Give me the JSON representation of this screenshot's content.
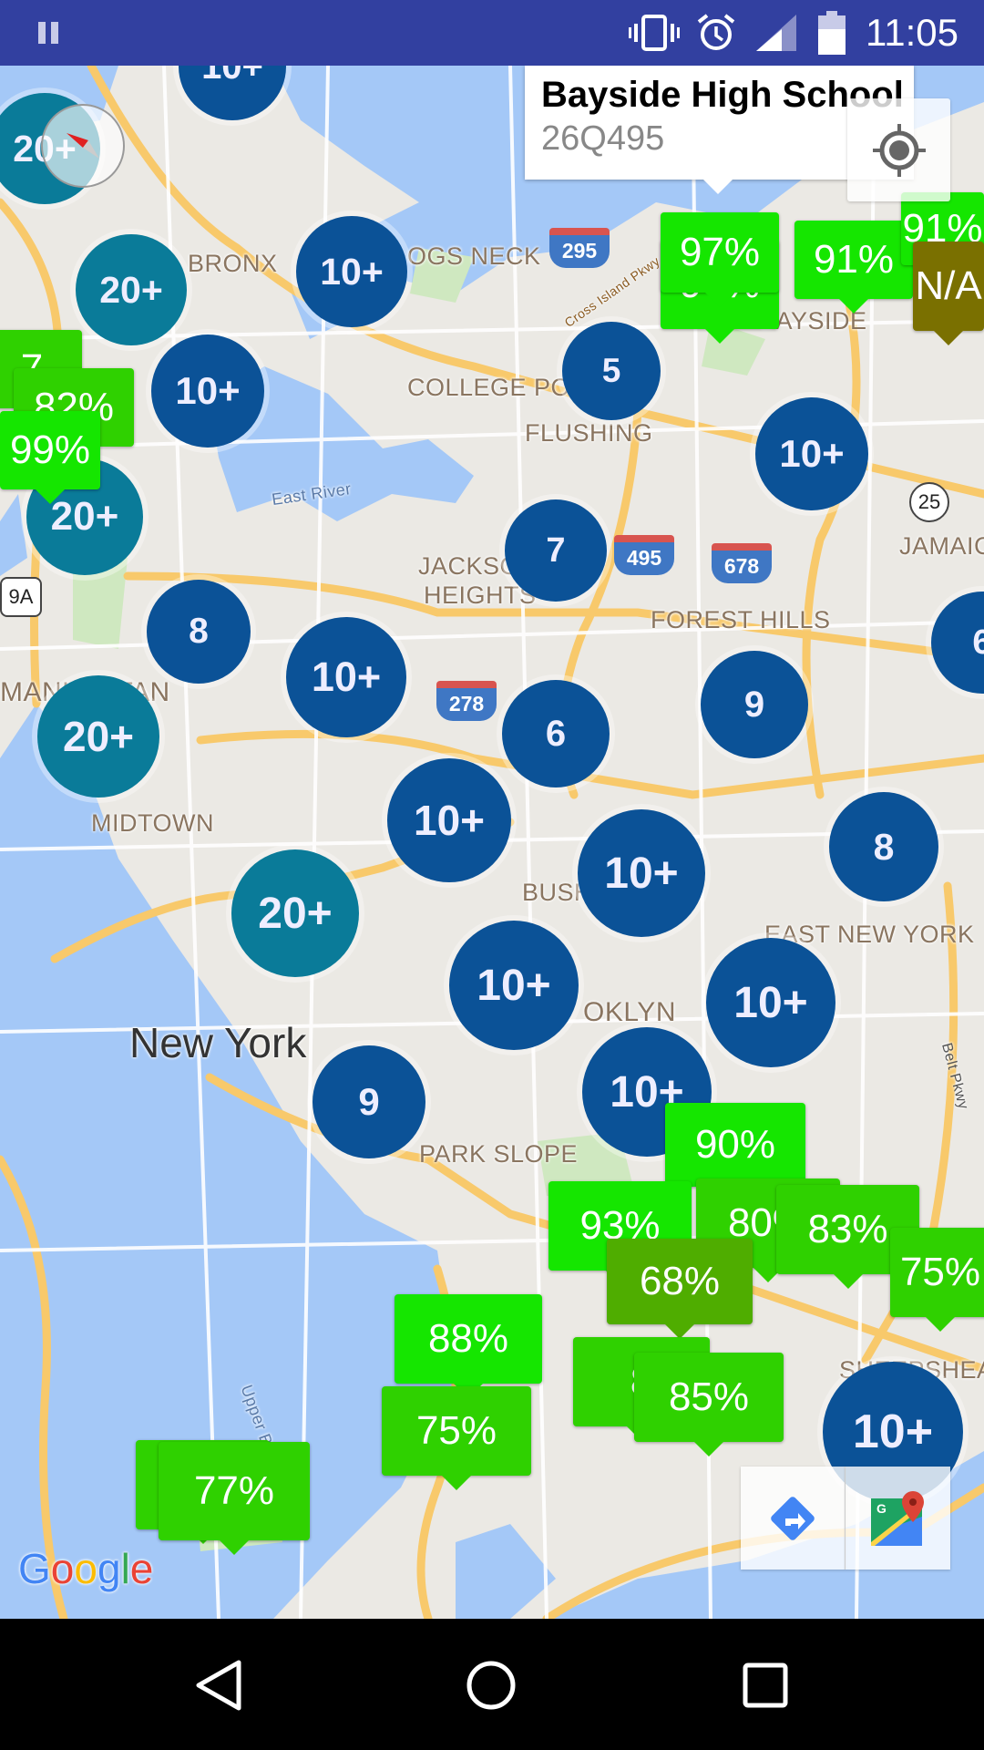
{
  "status_bar": {
    "time": "11:05",
    "icons": [
      "pause-icon",
      "vibrate-icon",
      "alarm-icon",
      "signal-icon",
      "battery-icon"
    ],
    "color": "#3240a0"
  },
  "info_window": {
    "title": "Bayside High School",
    "subtitle": "26Q495"
  },
  "map_labels": {
    "bronx": "BRONX",
    "throgs_neck": "OGS NECK",
    "college_point": "COLLEGE POI",
    "flushing": "FLUSHING",
    "bayside": "BAYSIDE",
    "jackson_heights_1": "JACKSON",
    "jackson_heights_2": "HEIGHTS",
    "forest_hills": "FOREST HILLS",
    "jamaica": "JAMAIC",
    "manhattan": "MANHATTAN",
    "midtown": "MIDTOWN",
    "bushwick": "BUSH",
    "east_new_york": "EAST NEW YORK",
    "brooklyn": "OKLYN",
    "new_york": "New York",
    "park_slope": "PARK SLOPE",
    "sheepshead": "SHEEPSHEAD",
    "east_river": "East River",
    "upper_bay": "Upper Bay",
    "belt_pkwy": "Belt Pkwy",
    "cross_island": "Cross Island Pkwy"
  },
  "shields": [
    "295",
    "495",
    "678",
    "278",
    "25",
    "9A"
  ],
  "clusters": [
    "10+",
    "20+",
    "20+",
    "10+",
    "10+",
    "5",
    "10+",
    "20+",
    "7",
    "8",
    "10+",
    "6",
    "9",
    "6",
    "20+",
    "10+",
    "10+",
    "8",
    "20+",
    "10+",
    "10+",
    "9",
    "10+",
    "10+"
  ],
  "cluster_colors": {
    "teal": "#0a7b99",
    "blue": "#0b5297"
  },
  "school_markers": [
    "9?%",
    "97%",
    "91%",
    "91%",
    "N/A",
    "7",
    "82%",
    "99%",
    "90%",
    "93%",
    "80%",
    "83%",
    "75%",
    "68%",
    "88%",
    "8",
    "85%",
    "75%",
    "77%",
    "77%"
  ],
  "marker_colors": {
    "high": "#15e600",
    "mid": "#2fd100",
    "low": "#4fad00",
    "na": "#7a7000"
  },
  "attribution": "Google",
  "map_toolbar": [
    "directions-icon",
    "google-maps-icon"
  ],
  "nav_bar": [
    "back-icon",
    "home-icon",
    "recents-icon"
  ]
}
